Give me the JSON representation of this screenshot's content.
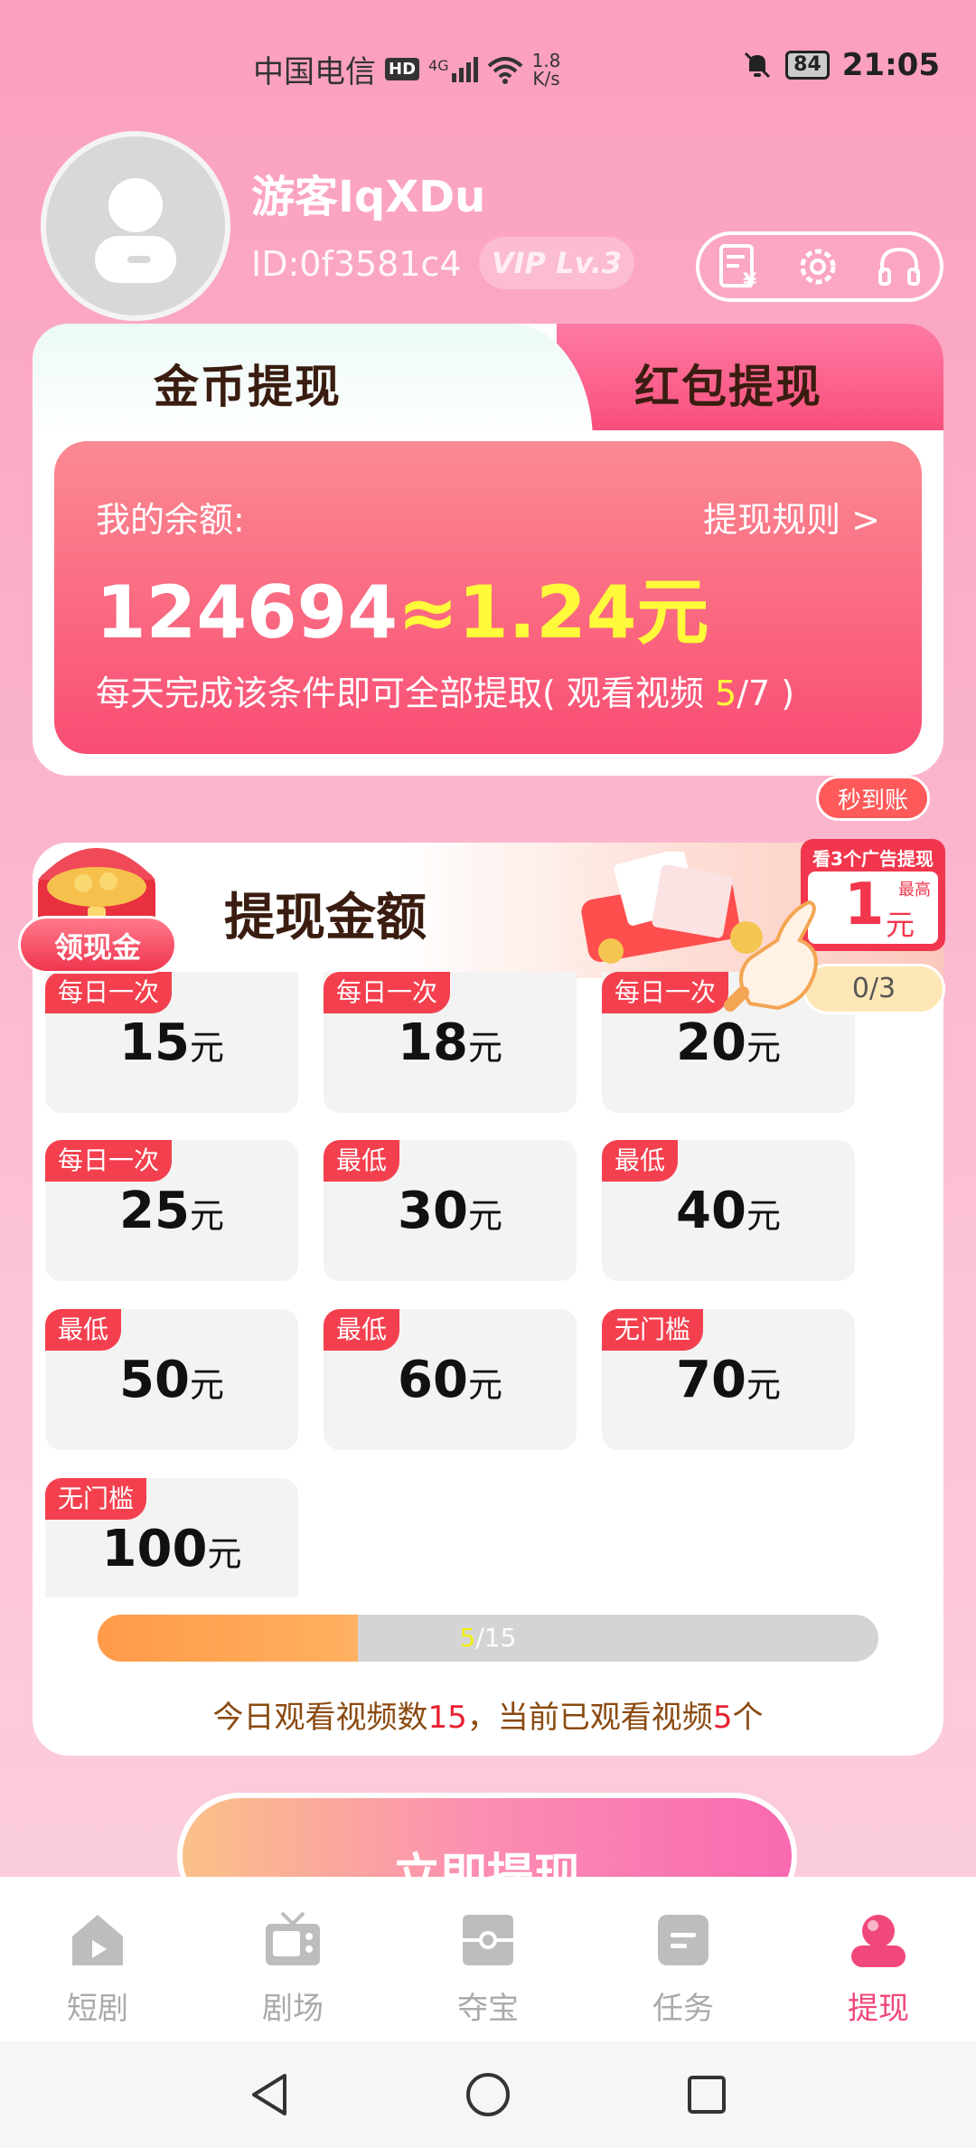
{
  "status_bar": {
    "carrier": "中国电信",
    "hd_badge": "HD",
    "network": "4G",
    "speed_value": "1.8",
    "speed_unit": "K/s",
    "battery": "84",
    "time": "21:05"
  },
  "profile": {
    "username": "游客IqXDu",
    "user_id": "ID:0f3581c4",
    "vip": "VIP Lv.3",
    "tools": [
      "bill-icon",
      "gear-icon",
      "headset-icon"
    ]
  },
  "tabs": {
    "coin_withdraw": "金币提现",
    "redpacket_withdraw": "红包提现"
  },
  "balance": {
    "label": "我的余额:",
    "rules": "提现规则 >",
    "coins": "124694",
    "yuan": "≈1.24元",
    "condition_prefix": "每天完成该条件即可全部提取( 观看视频 ",
    "condition_current": "5",
    "condition_suffix": "/7 )"
  },
  "withdraw": {
    "title": "提现金额",
    "receive_gold": "领现金",
    "instant": "秒到账",
    "ad_title": "看3个广告提现",
    "ad_amount": "1",
    "ad_unit": "元",
    "ad_max": "最高",
    "ad_progress": "0/3",
    "unit": "元",
    "options": [
      {
        "tag": "",
        "amount": ""
      },
      {
        "tag": "",
        "amount": ""
      },
      {
        "tag": "",
        "amount": ""
      },
      {
        "tag": "每日一次",
        "amount": "15"
      },
      {
        "tag": "每日一次",
        "amount": "18"
      },
      {
        "tag": "每日一次",
        "amount": "20"
      },
      {
        "tag": "每日一次",
        "amount": "25"
      },
      {
        "tag": "最低",
        "amount": "30"
      },
      {
        "tag": "最低",
        "amount": "40"
      },
      {
        "tag": "最低",
        "amount": "50"
      },
      {
        "tag": "最低",
        "amount": "60"
      },
      {
        "tag": "无门槛",
        "amount": "70"
      },
      {
        "tag": "无门槛",
        "amount": "100"
      }
    ],
    "progress": {
      "current": "5",
      "total": "/15",
      "fraction": 0.333
    },
    "watch_prefix": "今日观看视频数",
    "watch_total": "15",
    "watch_mid": "，当前已观看视频",
    "watch_current": "5",
    "watch_suffix": "个",
    "cta": "立即提现"
  },
  "nav": [
    {
      "label": "短剧",
      "icon": "home-play-icon"
    },
    {
      "label": "剧场",
      "icon": "tv-icon"
    },
    {
      "label": "夺宝",
      "icon": "treasure-icon"
    },
    {
      "label": "任务",
      "icon": "task-icon"
    },
    {
      "label": "提现",
      "icon": "user-icon"
    }
  ],
  "colors": {
    "accent": "#f94d73",
    "active_nav": "#f0487a",
    "tag": "#f4404e",
    "highlight": "#fffb3a"
  }
}
